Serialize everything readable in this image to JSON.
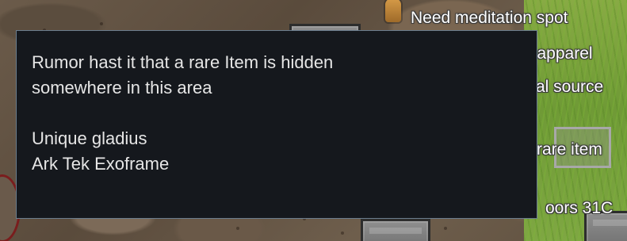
{
  "overlay_status_lines": [
    "Need meditation spot",
    "l apparel",
    "al source",
    "rare item",
    "oors 31C"
  ],
  "tooltip": {
    "lines": [
      "Rumor hast it that a rare Item is hidden",
      "somewhere in this area",
      "Unique gladius",
      "Ark Tek Exoframe"
    ]
  },
  "colors": {
    "tooltip_background": "#15181d",
    "tooltip_border": "#6b7d8e",
    "tooltip_text": "#e6e6e6",
    "status_text": "#ffffff"
  }
}
